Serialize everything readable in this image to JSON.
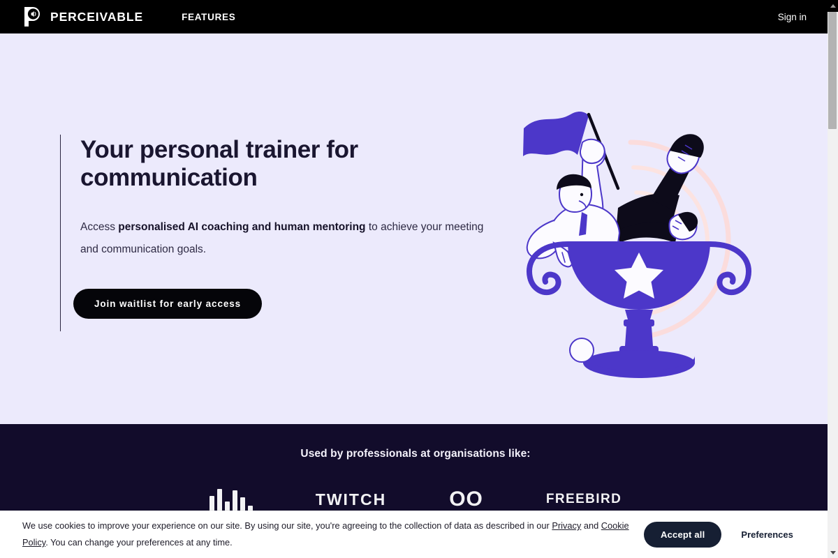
{
  "header": {
    "logo_icon": "perceivable-p-speaker-logo",
    "brand": "PERCEIVABLE",
    "nav": [
      {
        "label": "FEATURES",
        "name": "nav-features"
      }
    ],
    "signin": "Sign in"
  },
  "hero": {
    "title": "Your personal trainer for communication",
    "subtitle_lead": "Access ",
    "subtitle_bold": "personalised AI coaching and human mentoring",
    "subtitle_tail": " to achieve your meeting and communication goals.",
    "cta": "Join waitlist for early access",
    "illustration_name": "person-in-trophy-with-flag-illustration",
    "bg": "#ECEAFC",
    "accent": "#4C37C9",
    "arc_color": "#FDE4E4"
  },
  "social_proof": {
    "heading": "Used by professionals at organisations like:",
    "bg": "#120C2B",
    "logos": [
      {
        "name": "logo-bars",
        "label": ""
      },
      {
        "name": "logo-twitch",
        "label": "TWITCH"
      },
      {
        "name": "logo-oo",
        "label": "OO"
      },
      {
        "name": "logo-freebird",
        "label": "FREEBIRD"
      }
    ]
  },
  "cookie_banner": {
    "text_1": "We use cookies to improve your experience on our site. By using our site, you're agreeing to the collection of data as described in our ",
    "link_privacy": "Privacy",
    "text_2": " and ",
    "link_cookie": "Cookie Policy",
    "text_3": ". You can change your preferences at any time.",
    "accept": "Accept all",
    "preferences": "Preferences"
  },
  "scrollbar": {
    "up_icon": "chevron-up-icon",
    "down_icon": "chevron-down-icon"
  }
}
